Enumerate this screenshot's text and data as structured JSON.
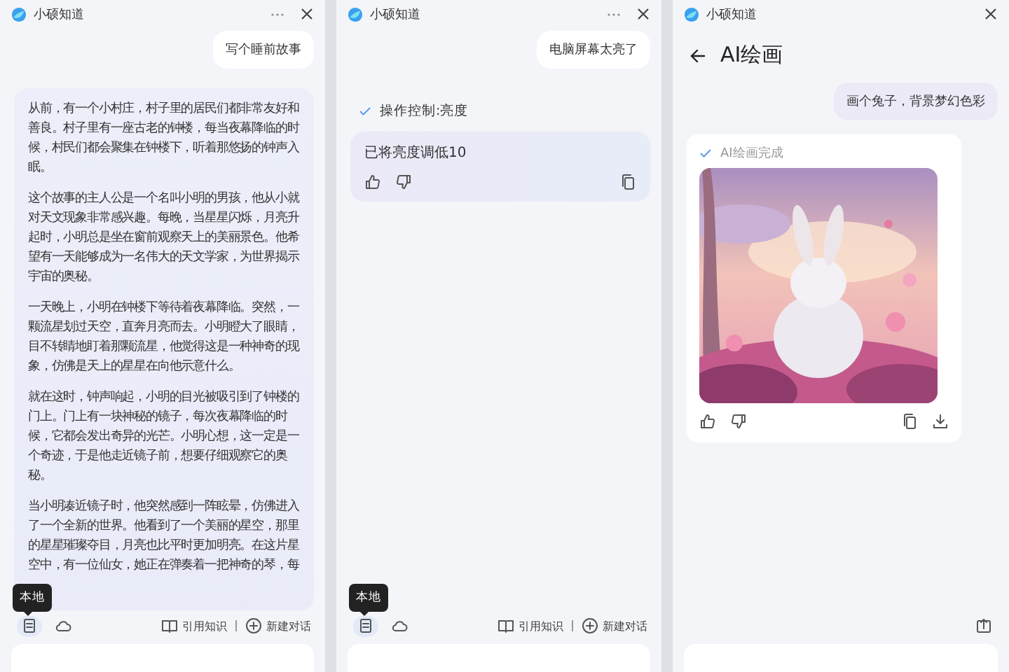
{
  "panels": [
    {
      "title": "小硕知道",
      "has_more": true,
      "messages": [
        {
          "kind": "user",
          "tinted": false,
          "text": "写个睡前故事"
        },
        {
          "kind": "answer",
          "paragraphs": [
            "从前，有一个小村庄，村子里的居民们都非常友好和善良。村子里有一座古老的钟楼，每当夜幕降临的时候，村民们都会聚集在钟楼下，听着那悠扬的钟声入眠。",
            "这个故事的主人公是一个名叫小明的男孩，他从小就对天文现象非常感兴趣。每晚，当星星闪烁，月亮升起时，小明总是坐在窗前观察天上的美丽景色。他希望有一天能够成为一名伟大的天文学家，为世界揭示宇宙的奥秘。",
            "一天晚上，小明在钟楼下等待着夜幕降临。突然，一颗流星划过天空，直奔月亮而去。小明瞪大了眼睛，目不转睛地盯着那颗流星，他觉得这是一种神奇的现象，仿佛是天上的星星在向他示意什么。",
            "就在这时，钟声响起，小明的目光被吸引到了钟楼的门上。门上有一块神秘的镜子，每次夜幕降临的时候，它都会发出奇异的光芒。小明心想，这一定是一个奇迹，于是他走近镜子前，想要仔细观察它的奥秘。",
            "当小明凑近镜子时，他突然感到一阵眩晕，仿佛进入了一个全新的世界。他看到了一个美丽的星空，那里的星星璀璨夺目，月亮也比平时更加明亮。在这片星空中，有一位仙女，她正在弹奏着一把神奇的琴，每"
          ]
        }
      ],
      "toolbar": {
        "tooltip": "本地",
        "modes": [
          {
            "selected": true
          },
          {
            "selected": false
          }
        ],
        "links": [
          "引用知识",
          "新建对话"
        ]
      }
    },
    {
      "title": "小硕知道",
      "has_more": true,
      "messages": [
        {
          "kind": "user",
          "tinted": false,
          "text": "电脑屏幕太亮了"
        },
        {
          "kind": "status",
          "text": "操作控制:亮度"
        },
        {
          "kind": "reply",
          "text": "已将亮度调低10"
        }
      ],
      "toolbar": {
        "tooltip": "本地",
        "modes": [
          {
            "selected": true
          },
          {
            "selected": false
          }
        ],
        "links": [
          "引用知识",
          "新建对话"
        ]
      }
    },
    {
      "title": "小硕知道",
      "has_more": false,
      "heading": "AI绘画",
      "messages": [
        {
          "kind": "user",
          "tinted": true,
          "text": "画个兔子，背景梦幻色彩"
        },
        {
          "kind": "image_card",
          "status": "AI绘画完成"
        }
      ],
      "has_export": true
    }
  ]
}
